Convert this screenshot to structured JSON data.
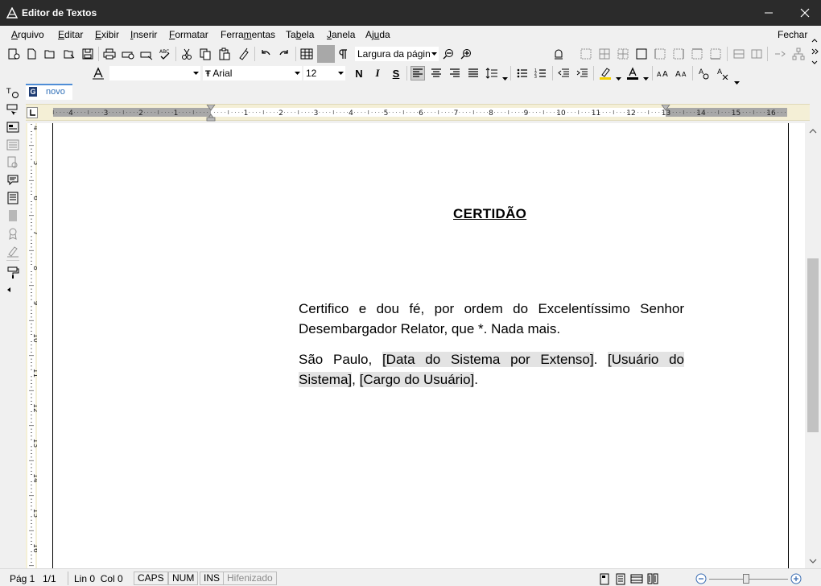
{
  "window": {
    "title": "Editor de Textos"
  },
  "menu": {
    "items": [
      {
        "label": "Arquivo",
        "first": "A",
        "rest": "rquivo"
      },
      {
        "label": "Editar",
        "first": "E",
        "rest": "ditar"
      },
      {
        "label": "Exibir",
        "first": "E",
        "rest": "xibir"
      },
      {
        "label": "Inserir",
        "first": "I",
        "rest": "nserir"
      },
      {
        "label": "Formatar",
        "first": "F",
        "rest": "ormatar"
      },
      {
        "label": "Ferramentas",
        "first": "Ferra",
        "ul": "m",
        "rest": "entas"
      },
      {
        "label": "Tabela",
        "first": "Ta",
        "ul": "b",
        "rest": "ela"
      },
      {
        "label": "Janela",
        "first": "J",
        "rest": "anela"
      },
      {
        "label": "Ajuda",
        "first": "Aj",
        "ul": "u",
        "rest": "da"
      }
    ],
    "close_label": "Fechar"
  },
  "toolbar": {
    "zoom_value": "Largura da págin",
    "style_value": "",
    "font_value": "Arial",
    "size_value": "12",
    "bold_label": "N",
    "italic_label": "I",
    "underline_label": "S"
  },
  "tab": {
    "label": "novo",
    "icon_letter": "G"
  },
  "ruler": {
    "marks": [
      "4",
      "3",
      "2",
      "1",
      "1",
      "2",
      "3",
      "4",
      "5",
      "6",
      "7",
      "8",
      "9",
      "10",
      "11",
      "12",
      "13",
      "14",
      "15",
      "16"
    ],
    "vmarks": [
      "4",
      "5",
      "6",
      "7",
      "8",
      "9",
      "10",
      "11",
      "12",
      "13",
      "14",
      "15",
      "16"
    ]
  },
  "document": {
    "title": "CERTIDÃO",
    "para1": "Certifico e dou fé, por ordem do Excelentíssimo Senhor Desembargador Relator, que *. Nada mais.",
    "para2_prefix": "São Paulo, ",
    "field_date": "[Data do Sistema por Extenso]",
    "para2_sep1": ". ",
    "field_user": "[Usuário do Sistema]",
    "para2_sep2": ", ",
    "field_role": "[Cargo do Usuário]",
    "para2_end": "."
  },
  "status": {
    "page": "Pág 1",
    "pages": "1/1",
    "position": "Lin 0  Col 0",
    "caps": "CAPS",
    "num": "NUM",
    "ins": "INS",
    "hyphen": "Hifenizado"
  },
  "colors": {
    "titlebar": "#2b2b2b",
    "ruler": "#f4efd6",
    "field_highlight": "#e3e3e3",
    "tab_accent": "#4f8dd6"
  }
}
